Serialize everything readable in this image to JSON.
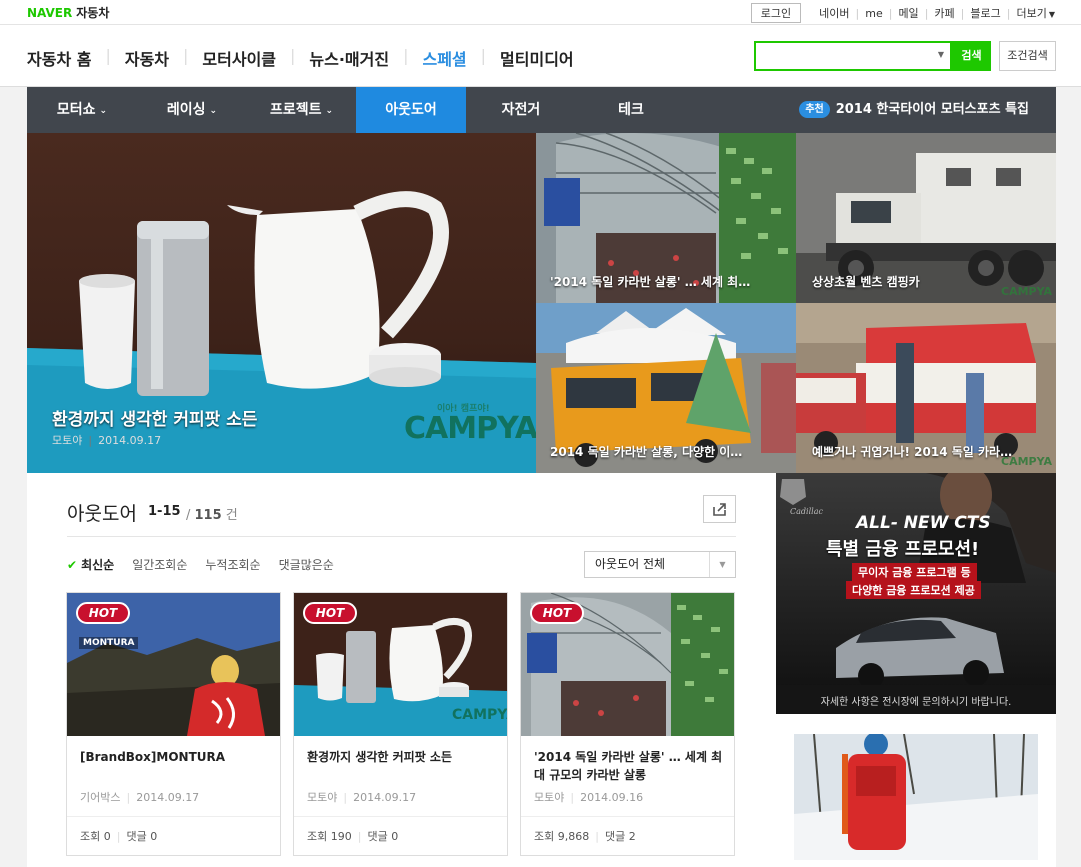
{
  "top": {
    "logo_brand": "NAVER",
    "logo_section": "자동차",
    "login": "로그인",
    "links": [
      "네이버",
      "me",
      "메일",
      "카페",
      "블로그",
      "더보기"
    ]
  },
  "gnb": {
    "menu": [
      "자동차 홈",
      "자동차",
      "모터사이클",
      "뉴스·매거진",
      "스페셜",
      "멀티미디어"
    ],
    "active": "스페셜",
    "search_placeholder": "",
    "search_button": "검색",
    "advanced_button": "조건검색"
  },
  "subnav": {
    "tabs": [
      "모터쇼",
      "레이싱",
      "프로젝트",
      "아웃도어",
      "자전거",
      "테크"
    ],
    "active": "아웃도어",
    "recommend_badge": "추천",
    "recommend_text": "2014 한국타이어 모터스포츠 특집"
  },
  "hero": {
    "main": {
      "title": "환경까지 생각한 커피팟 소든",
      "source": "모토야",
      "date": "2014.09.17",
      "watermark_small": "이아! 캠프야!",
      "watermark": "CAMPYA"
    },
    "tiles": [
      {
        "title": "'2014 독일 카라반 살롱' … 세계 최…"
      },
      {
        "title": "상상초월 벤츠 캠핑카",
        "watermark": "CAMPYA"
      },
      {
        "title": "2014 독일 카라반 살롱, 다양한 이…"
      },
      {
        "title": "예쁘거나 귀엽거나! 2014 독일 카라…",
        "watermark": "CAMPYA"
      }
    ]
  },
  "content": {
    "title": "아웃도어",
    "range": "1-15",
    "total": "115",
    "unit": "건",
    "sort": [
      "최신순",
      "일간조회순",
      "누적조회순",
      "댓글많은순"
    ],
    "filter": "아웃도어 전체"
  },
  "cards": [
    {
      "badge": "HOT",
      "title": "[BrandBox]MONTURA",
      "source": "기어박스",
      "date": "2014.09.17",
      "views_label": "조회",
      "views": "0",
      "comments_label": "댓글",
      "comments": "0",
      "brand_tag": "MONTURA"
    },
    {
      "badge": "HOT",
      "title": "환경까지 생각한 커피팟 소든",
      "source": "모토야",
      "date": "2014.09.17",
      "views_label": "조회",
      "views": "190",
      "comments_label": "댓글",
      "comments": "0",
      "watermark": "CAMPYA"
    },
    {
      "badge": "HOT",
      "title": "'2014 독일 카라반 살롱' … 세계 최대 규모의 카라반 살롱",
      "source": "모토야",
      "date": "2014.09.16",
      "views_label": "조회",
      "views": "9,868",
      "comments_label": "댓글",
      "comments": "2"
    }
  ],
  "ad": {
    "brand": "Cadillac",
    "headline": "ALL- NEW CTS",
    "promo": "특별 금융 프로모션!",
    "line1": "무이자 금융 프로그램 등",
    "line2": "다양한 금융 프로모션 제공",
    "footnote": "자세한 사항은 전시장에 문의하시기 바랍니다."
  },
  "colors": {
    "naver_green": "#1ec800",
    "accent_blue": "#1f8ae0",
    "subnav_bg": "#41464d",
    "hot_red": "#c8102e"
  }
}
